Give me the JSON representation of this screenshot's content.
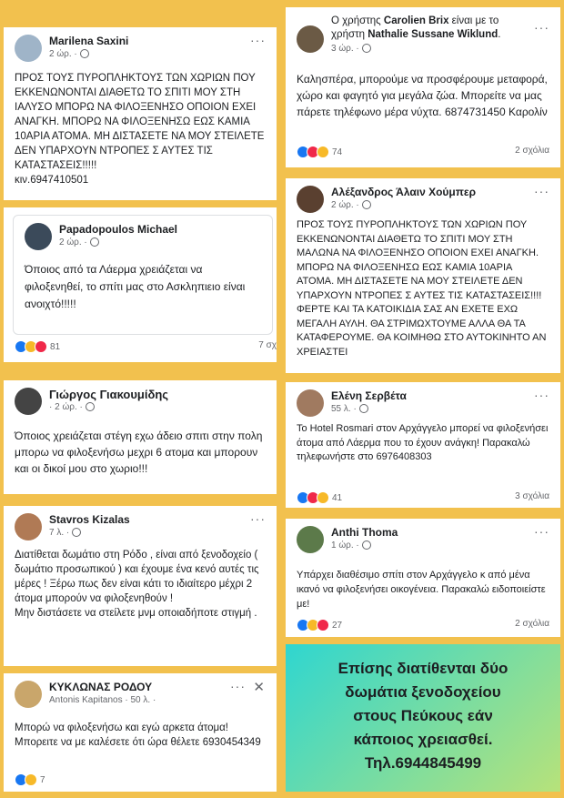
{
  "posts": [
    {
      "name": "Marilena Saxini",
      "time": "2 ώρ. ·",
      "text": "ΠΡΟΣ ΤΟΥΣ ΠΥΡΟΠΛΗΚΤΟΥΣ ΤΩΝ ΧΩΡΙΩΝ ΠΟΥ ΕΚΚΕΝΩΝΟΝΤΑΙ ΔΙΑΘΕΤΩ ΤΟ ΣΠΙΤΙ ΜΟΥ ΣΤΗ ΙΑΛΥΣΟ ΜΠΟΡΩ ΝΑ ΦΙΛΟΞΕΝΗΣΟ ΟΠΟΙΟΝ ΕΧΕΙ ΑΝΑΓΚΗ. ΜΠΟΡΩ ΝΑ ΦΙΛΟΞΕΝΗΣΩ ΕΩΣ ΚΑΜΙΑ 10ΑΡΙΑ ΑΤΟΜΑ. ΜΗ ΔΙΣΤΑΣΕΤΕ ΝΑ ΜΟΥ ΣΤΕΙΛΕΤΕ ΔΕΝ ΥΠΑΡΧΟΥΝ ΝΤΡΟΠΕΣ Σ ΑΥΤΕΣ ΤΙΣ ΚΑΤΑΣΤΑΣΕΙΣ!!!!!",
      "phone": "κιν.6947410501"
    },
    {
      "name": "Papadopoulos Michael",
      "time": "2 ώρ. ·",
      "text": "Όποιος από τα Λάερμα χρειάζεται να φιλοξενηθεί, το σπίτι μας στο Ασκληπιειο είναι ανοιχτό!!!!!",
      "reactions": "81",
      "comments": "7 σχ"
    },
    {
      "name": "Γιώργος Γιακουμίδης",
      "time": "· 2 ώρ. ·",
      "text": "Όποιος χρειάζεται στέγη εχω άδειο σπιτι στην πολη μπορω να φιλοξενήσω μεχρι 6 ατομα και μπορουν και οι δικοί μου στο χωριο!!!"
    },
    {
      "name": "Stavros Kizalas",
      "time": "7 λ. ·",
      "text": "Διατίθεται δωμάτιο στη Ρόδο , είναι από ξενοδοχείο ( δωμάτιο προσωπικού ) και έχουμε ένα κενό αυτές τις μέρες ! Ξέρω πως δεν είναι κάτι το ιδιαίτερο μέχρι 2 άτομα μπορούν να φιλοξενηθούν !",
      "text2": "Μην διστάσετε να στείλετε μνμ οποιαδήποτε στιγμή ."
    },
    {
      "name": "ΚΥΚΛΩΝΑΣ ΡΟΔΟΥ",
      "sub": "Antonis Kapitanos · 50 λ. ·",
      "text": "Μπορώ να φιλοξενήσω και εγώ αρκετα άτομα! Μπορειτε να με καλέσετε ότι ώρα θέλετε 6930454349",
      "reactions": "7",
      "close": "✕"
    },
    {
      "name": "Ο χρήστης Carolien Brix είναι με το χρήστη Nathalie Sussane Wiklund.",
      "name_a": "Carolien Brix",
      "name_b": "Nathalie Sussane Wiklund",
      "time": "3 ώρ. ·",
      "text": "Καλησπέρα, μπορούμε να προσφέρουμε μεταφορά, χώρο και φαγητό για μεγάλα ζώα. Μπορείτε να μας πάρετε τηλέφωνο μέρα νύχτα. 6874731450 Καρολίν",
      "reactions": "74",
      "comments": "2 σχόλια"
    },
    {
      "name": "Αλέξανδρος Άλαιν Χούμπερ",
      "time": "2 ώρ. ·",
      "text": "ΠΡΟΣ ΤΟΥΣ ΠΥΡΟΠΛΗΚΤΟΥΣ ΤΩΝ ΧΩΡΙΩΝ ΠΟΥ ΕΚΚΕΝΩΝΟΝΤΑΙ ΔΙΑΘΕΤΩ ΤΟ ΣΠΙΤΙ ΜΟΥ ΣΤΗ ΜΑΛΩΝΑ ΝΑ ΦΙΛΟΞΕΝΗΣΟ ΟΠΟΙΟΝ ΕΧΕΙ ΑΝΑΓΚΗ. ΜΠΟΡΩ ΝΑ ΦΙΛΟΞΕΝΗΣΩ ΕΩΣ ΚΑΜΙΑ 10ΑΡΙΑ ΑΤΟΜΑ. ΜΗ ΔΙΣΤΑΣΕΤΕ ΝΑ ΜΟΥ ΣΤΕΙΛΕΤΕ ΔΕΝ ΥΠΑΡΧΟΥΝ ΝΤΡΟΠΕΣ Σ ΑΥΤΕΣ ΤΙΣ ΚΑΤΑΣΤΑΣΕΙΣ!!!! ΦΕΡΤΕ ΚΑΙ ΤΑ ΚΑΤΟΙΚΙΔΙΑ ΣΑΣ ΑΝ ΕΧΕΤΕ ΕΧΩ ΜΕΓΑΛΗ ΑΥΛΗ. ΘΑ ΣΤΡΙΜΩΧΤΟΥΜΕ ΑΛΛΑ ΘΑ ΤΑ ΚΑΤΑΦΕΡΟΥΜΕ. ΘΑ ΚΟΙΜΗΘΩ ΣΤΟ ΑΥΤΟΚΙΝΗΤΟ ΑΝ ΧΡΕΙΑΣΤΕΙ"
    },
    {
      "name": "Ελένη Σερβέτα",
      "time": "55 λ. ·",
      "text": "Το  Hotel Rosmari στον Αρχάγγελο μπορεί να φιλοξενήσει άτομα από Λάερμα που το έχουν ανάγκη! Παρακαλώ τηλεφωνήστε στο 6976408303",
      "reactions": "41",
      "comments": "3 σχόλια"
    },
    {
      "name": "Anthi Thoma",
      "time": "1 ώρ. ·",
      "text": "Υπάρχει διαθέσιμο σπίτι στον Αρχάγγελο κ από μένα ικανό να φιλοξενήσει οικογένεια. Παρακαλώ ειδοποιείστε με!",
      "reactions": "27",
      "comments": "2 σχόλια"
    }
  ],
  "banner": {
    "lines": [
      "Επίσης διατίθενται δύο",
      "δωμάτια ξενοδοχείου",
      "στους  Πεύκους εάν",
      "κάποιος χρειασθεί.",
      "Τηλ.6944845499"
    ]
  },
  "colors": {
    "background": "#f2c14e",
    "banner_gradient": [
      "#2fd6d0",
      "#b7e27a"
    ]
  }
}
